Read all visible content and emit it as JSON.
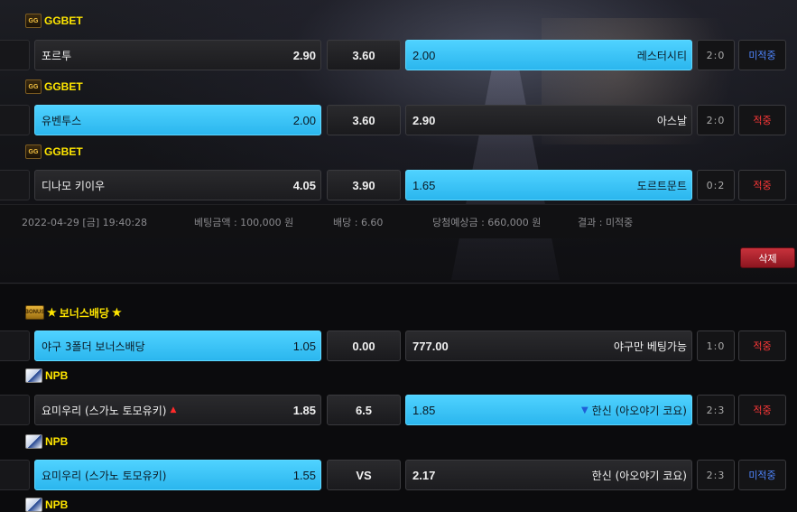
{
  "bet_slip_1": {
    "games": [
      {
        "league": "GGBET",
        "home": {
          "team": "포르투",
          "odds": "2.90",
          "selected": false
        },
        "draw": "3.60",
        "away": {
          "team": "레스터시티",
          "odds": "2.00",
          "selected": true
        },
        "score": "2:0",
        "result": "미적중"
      },
      {
        "league": "GGBET",
        "home": {
          "team": "유벤투스",
          "odds": "2.00",
          "selected": true
        },
        "draw": "3.60",
        "away": {
          "team": "아스날",
          "odds": "2.90",
          "selected": false
        },
        "score": "2:0",
        "result": "적중"
      },
      {
        "league": "GGBET",
        "home": {
          "team": "디나모 키이우",
          "odds": "4.05",
          "selected": false
        },
        "draw": "3.90",
        "away": {
          "team": "도르트문트",
          "odds": "1.65",
          "selected": true
        },
        "score": "0:2",
        "result": "적중"
      }
    ],
    "summary": {
      "datetime": "2022-04-29 [금] 19:40:28",
      "bet_amount": "베팅금액 : 100,000 원",
      "odds": "배당 : 6.60",
      "expected_win": "당첨예상금 : 660,000 원",
      "result": "결과 : 미적중"
    },
    "delete_label": "삭제"
  },
  "bet_slip_2": {
    "games": [
      {
        "league": "보너스배당",
        "league_logo": "BONUS",
        "home": {
          "team": "야구 3폴더 보너스배당",
          "odds": "1.05",
          "selected": true
        },
        "draw": "0.00",
        "away": {
          "team": "야구만 베팅가능",
          "odds": "777.00",
          "selected": false
        },
        "score": "1:0",
        "result": "적중"
      },
      {
        "league": "NPB",
        "home": {
          "team": "요미우리 (스가노 토모유키)",
          "odds": "1.85",
          "selected": false,
          "arrow": "▲"
        },
        "draw": "6.5",
        "away": {
          "team": "한신 (아오야기 코요)",
          "odds": "1.85",
          "selected": true,
          "arrow": "▼"
        },
        "score": "2:3",
        "result": "적중"
      },
      {
        "league": "NPB",
        "home": {
          "team": "요미우리 (스가노 토모유키)",
          "odds": "1.55",
          "selected": true
        },
        "draw": "VS",
        "away": {
          "team": "한신 (아오야기 코요)",
          "odds": "2.17",
          "selected": false
        },
        "score": "2:3",
        "result": "미적중"
      },
      {
        "league": "NPB"
      }
    ]
  },
  "colors": {
    "selected": "#2bb6ee",
    "league_text": "#ffe600",
    "pending": "#4f86ff",
    "hit": "#ff3838",
    "delete_button": "#c8323c"
  }
}
